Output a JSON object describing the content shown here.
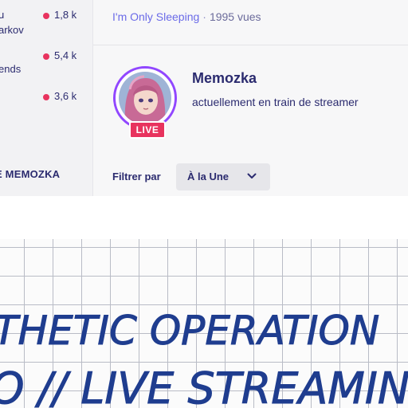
{
  "sidebar": {
    "rows": [
      {
        "name_fragment": "u",
        "viewers": "1,8 k"
      },
      {
        "name_fragment": "arkov",
        "viewers": ""
      },
      {
        "name_fragment": "",
        "viewers": "5,4 k"
      },
      {
        "name_fragment": "ends",
        "viewers": ""
      },
      {
        "name_fragment": "",
        "viewers": "3,6 k"
      }
    ],
    "footer_label": "E MEMOZKA"
  },
  "video": {
    "title": "I'm Only Sleeping",
    "separator": "·",
    "views": "1995 vues"
  },
  "channel": {
    "name": "Memozka",
    "status": "actuellement en train de streamer",
    "live_badge": "LIVE"
  },
  "filter": {
    "label": "Filtrer par",
    "selected": "À la Une"
  },
  "notebook": {
    "line1": "THETIC OPERATION",
    "line2": "O // LIVE STREAMING"
  },
  "colors": {
    "live": "#e8335e",
    "accent": "#9147ff",
    "link": "#6b6be8",
    "text": "#2b2b6f",
    "ink": "#1f3d8f"
  }
}
